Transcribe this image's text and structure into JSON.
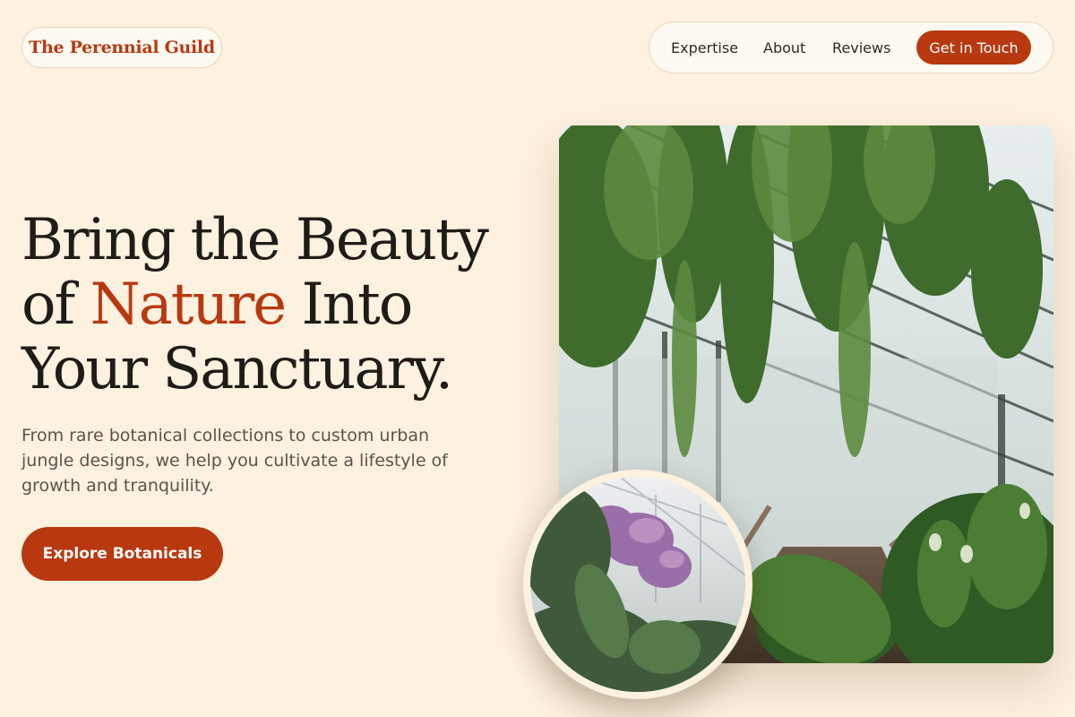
{
  "brand": {
    "name": "The Perennial Guild"
  },
  "nav": {
    "links": [
      "Expertise",
      "About",
      "Reviews"
    ],
    "cta": "Get in Touch"
  },
  "hero": {
    "headline_line1": "Bring the Beauty",
    "headline_line2_before": "of",
    "headline_line2_accent": "Nature",
    "headline_line2_after": "Into",
    "headline_line3": "Your Sanctuary.",
    "subtext": "From rare botanical collections to custom urban jungle designs, we help you cultivate a lifestyle of growth and tranquility.",
    "cta": "Explore Botanicals"
  },
  "images": {
    "main": "greenhouse-interior-photo",
    "inset": "flowering-tree-greenhouse-photo"
  },
  "colors": {
    "background": "#fdf1df",
    "accent": "#b8390f",
    "text": "#1f1c18",
    "muted": "#5b544c"
  }
}
